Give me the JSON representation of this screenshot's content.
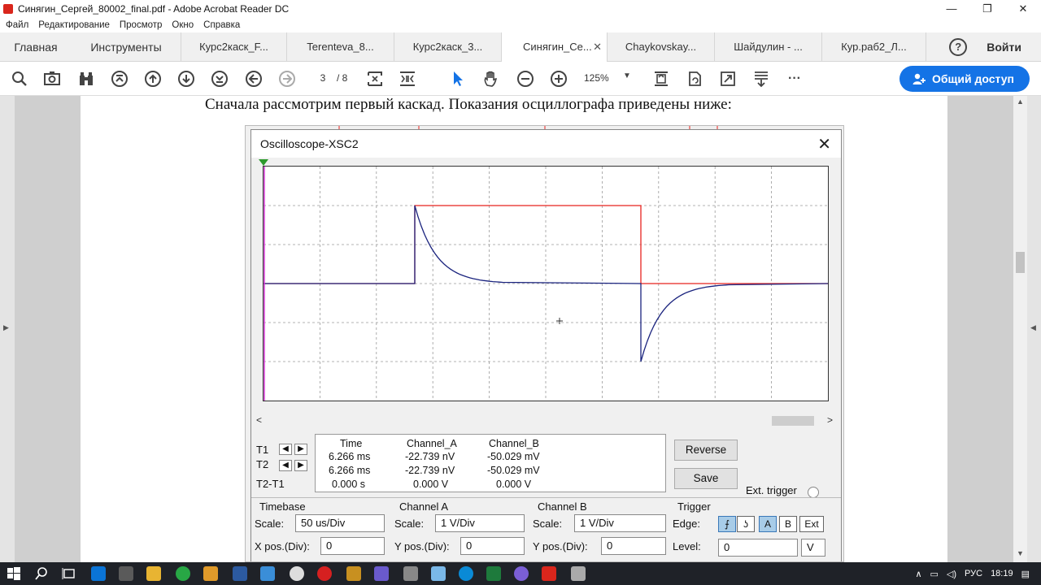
{
  "window": {
    "title": "Синягин_Сергей_80002_final.pdf - Adobe Acrobat Reader DC",
    "minimize": "—",
    "restore": "❐",
    "close": "✕"
  },
  "menu": [
    "Файл",
    "Редактирование",
    "Просмотр",
    "Окно",
    "Справка"
  ],
  "tabs": {
    "home": "Главная",
    "tools": "Инструменты",
    "docs": [
      {
        "label": "Курс2каск_F..."
      },
      {
        "label": "Terenteva_8..."
      },
      {
        "label": "Курс2каск_3..."
      },
      {
        "label": "Синягин_Се..."
      },
      {
        "label": "Chaykovskay..."
      },
      {
        "label": "Шайдулин - ..."
      },
      {
        "label": "Кур.раб2_Л..."
      }
    ],
    "active_close": "✕",
    "help": "?",
    "signin": "Войти"
  },
  "toolbar": {
    "page_current": "3",
    "page_total": "/ 8",
    "zoom": "125%",
    "more": "···",
    "share": "Общий доступ"
  },
  "document": {
    "text": "Сначала рассмотрим первый каскад. Показания осциллографа приведены ниже:"
  },
  "oscilloscope": {
    "title": "Oscilloscope-XSC2",
    "close": "✕",
    "cursors": {
      "t1": "T1",
      "t2": "T2",
      "diff": "T2-T1"
    },
    "readout": {
      "headers": {
        "time": "Time",
        "ch_a": "Channel_A",
        "ch_b": "Channel_B"
      },
      "t1": {
        "time": "6.266 ms",
        "ch_a": "-22.739 nV",
        "ch_b": "-50.029 mV"
      },
      "t2": {
        "time": "6.266 ms",
        "ch_a": "-22.739 nV",
        "ch_b": "-50.029 mV"
      },
      "diff": {
        "time": "0.000 s",
        "ch_a": "0.000 V",
        "ch_b": "0.000 V"
      }
    },
    "buttons": {
      "reverse": "Reverse",
      "save": "Save"
    },
    "ext_trigger": "Ext. trigger",
    "timebase": {
      "title": "Timebase",
      "scale_label": "Scale:",
      "scale": "50 us/Div",
      "pos_label": "X pos.(Div):",
      "pos": "0"
    },
    "channel_a": {
      "title": "Channel A",
      "scale_label": "Scale:",
      "scale": "1  V/Div",
      "pos_label": "Y pos.(Div):",
      "pos": "0"
    },
    "channel_b": {
      "title": "Channel B",
      "scale_label": "Scale:",
      "scale": "1  V/Div",
      "pos_label": "Y pos.(Div):",
      "pos": "0"
    },
    "trigger": {
      "title": "Trigger",
      "edge_label": "Edge:",
      "level_label": "Level:",
      "level": "0",
      "level_unit": "V",
      "src_a": "A",
      "src_b": "B",
      "src_ext": "Ext"
    },
    "trace_colors": {
      "channel_a": "#e8231f",
      "channel_b": "#1a237e"
    }
  },
  "taskbar": {
    "lang": "РУС",
    "time": "18:19"
  },
  "colors": {
    "share_button": "#1473e6",
    "taskbar": "#1f2228"
  }
}
